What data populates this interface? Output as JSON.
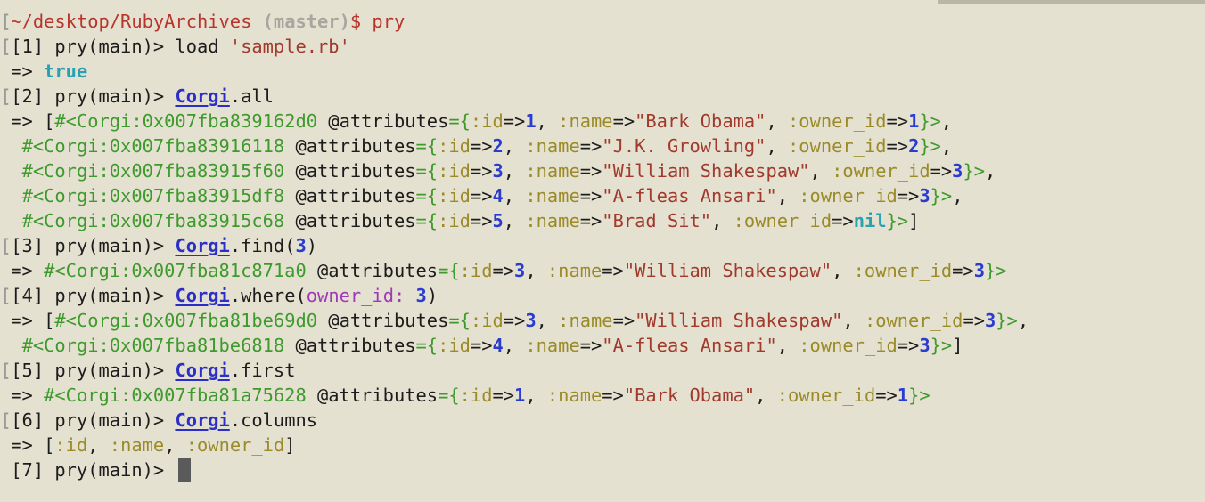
{
  "terminal": {
    "lines": [
      {
        "name": "shell-prompt-line",
        "segments": [
          {
            "t": "[",
            "c": "ed"
          },
          {
            "t": "~/desktop/RubyArchives",
            "c": "path"
          },
          {
            "t": " (master)",
            "c": "branch"
          },
          {
            "t": "$ pry",
            "c": "path"
          }
        ]
      },
      {
        "name": "pry-input-1",
        "segments": [
          {
            "t": "[",
            "c": "ed"
          },
          {
            "t": "[1] pry(main)> load ",
            "c": ""
          },
          {
            "t": "'sample.rb'",
            "c": "str"
          }
        ]
      },
      {
        "name": "pry-output-1",
        "segments": [
          {
            "t": " => ",
            "c": ""
          },
          {
            "t": "true",
            "c": "bool"
          }
        ]
      },
      {
        "name": "pry-input-2",
        "segments": [
          {
            "t": "[",
            "c": "ed"
          },
          {
            "t": "[2] pry(main)> ",
            "c": ""
          },
          {
            "t": "Corgi",
            "c": "cls"
          },
          {
            "t": ".all",
            "c": ""
          }
        ]
      },
      {
        "name": "pry-output-2-line-1",
        "segments": [
          {
            "t": " => [",
            "c": ""
          },
          {
            "t": "#<Corgi:0x007fba839162d0",
            "c": "obj"
          },
          {
            "t": " @attributes",
            "c": ""
          },
          {
            "t": "={",
            "c": "obj"
          },
          {
            "t": ":id",
            "c": "sym"
          },
          {
            "t": "=>",
            "c": ""
          },
          {
            "t": "1",
            "c": "num"
          },
          {
            "t": ", ",
            "c": ""
          },
          {
            "t": ":name",
            "c": "sym"
          },
          {
            "t": "=>",
            "c": ""
          },
          {
            "t": "\"Bark Obama\"",
            "c": "str"
          },
          {
            "t": ", ",
            "c": ""
          },
          {
            "t": ":owner_id",
            "c": "sym"
          },
          {
            "t": "=>",
            "c": ""
          },
          {
            "t": "1",
            "c": "num"
          },
          {
            "t": "}>",
            "c": "obj"
          },
          {
            "t": ",",
            "c": ""
          }
        ]
      },
      {
        "name": "pry-output-2-line-2",
        "segments": [
          {
            "t": "  ",
            "c": ""
          },
          {
            "t": "#<Corgi:0x007fba83916118",
            "c": "obj"
          },
          {
            "t": " @attributes",
            "c": ""
          },
          {
            "t": "={",
            "c": "obj"
          },
          {
            "t": ":id",
            "c": "sym"
          },
          {
            "t": "=>",
            "c": ""
          },
          {
            "t": "2",
            "c": "num"
          },
          {
            "t": ", ",
            "c": ""
          },
          {
            "t": ":name",
            "c": "sym"
          },
          {
            "t": "=>",
            "c": ""
          },
          {
            "t": "\"J.K. Growling\"",
            "c": "str"
          },
          {
            "t": ", ",
            "c": ""
          },
          {
            "t": ":owner_id",
            "c": "sym"
          },
          {
            "t": "=>",
            "c": ""
          },
          {
            "t": "2",
            "c": "num"
          },
          {
            "t": "}>",
            "c": "obj"
          },
          {
            "t": ",",
            "c": ""
          }
        ]
      },
      {
        "name": "pry-output-2-line-3",
        "segments": [
          {
            "t": "  ",
            "c": ""
          },
          {
            "t": "#<Corgi:0x007fba83915f60",
            "c": "obj"
          },
          {
            "t": " @attributes",
            "c": ""
          },
          {
            "t": "={",
            "c": "obj"
          },
          {
            "t": ":id",
            "c": "sym"
          },
          {
            "t": "=>",
            "c": ""
          },
          {
            "t": "3",
            "c": "num"
          },
          {
            "t": ", ",
            "c": ""
          },
          {
            "t": ":name",
            "c": "sym"
          },
          {
            "t": "=>",
            "c": ""
          },
          {
            "t": "\"William Shakespaw\"",
            "c": "str"
          },
          {
            "t": ", ",
            "c": ""
          },
          {
            "t": ":owner_id",
            "c": "sym"
          },
          {
            "t": "=>",
            "c": ""
          },
          {
            "t": "3",
            "c": "num"
          },
          {
            "t": "}>",
            "c": "obj"
          },
          {
            "t": ",",
            "c": ""
          }
        ]
      },
      {
        "name": "pry-output-2-line-4",
        "segments": [
          {
            "t": "  ",
            "c": ""
          },
          {
            "t": "#<Corgi:0x007fba83915df8",
            "c": "obj"
          },
          {
            "t": " @attributes",
            "c": ""
          },
          {
            "t": "={",
            "c": "obj"
          },
          {
            "t": ":id",
            "c": "sym"
          },
          {
            "t": "=>",
            "c": ""
          },
          {
            "t": "4",
            "c": "num"
          },
          {
            "t": ", ",
            "c": ""
          },
          {
            "t": ":name",
            "c": "sym"
          },
          {
            "t": "=>",
            "c": ""
          },
          {
            "t": "\"A-fleas Ansari\"",
            "c": "str"
          },
          {
            "t": ", ",
            "c": ""
          },
          {
            "t": ":owner_id",
            "c": "sym"
          },
          {
            "t": "=>",
            "c": ""
          },
          {
            "t": "3",
            "c": "num"
          },
          {
            "t": "}>",
            "c": "obj"
          },
          {
            "t": ",",
            "c": ""
          }
        ]
      },
      {
        "name": "pry-output-2-line-5",
        "segments": [
          {
            "t": "  ",
            "c": ""
          },
          {
            "t": "#<Corgi:0x007fba83915c68",
            "c": "obj"
          },
          {
            "t": " @attributes",
            "c": ""
          },
          {
            "t": "={",
            "c": "obj"
          },
          {
            "t": ":id",
            "c": "sym"
          },
          {
            "t": "=>",
            "c": ""
          },
          {
            "t": "5",
            "c": "num"
          },
          {
            "t": ", ",
            "c": ""
          },
          {
            "t": ":name",
            "c": "sym"
          },
          {
            "t": "=>",
            "c": ""
          },
          {
            "t": "\"Brad Sit\"",
            "c": "str"
          },
          {
            "t": ", ",
            "c": ""
          },
          {
            "t": ":owner_id",
            "c": "sym"
          },
          {
            "t": "=>",
            "c": ""
          },
          {
            "t": "nil",
            "c": "nil"
          },
          {
            "t": "}>",
            "c": "obj"
          },
          {
            "t": "]",
            "c": ""
          }
        ]
      },
      {
        "name": "pry-input-3",
        "segments": [
          {
            "t": "[",
            "c": "ed"
          },
          {
            "t": "[3] pry(main)> ",
            "c": ""
          },
          {
            "t": "Corgi",
            "c": "cls"
          },
          {
            "t": ".find(",
            "c": ""
          },
          {
            "t": "3",
            "c": "num"
          },
          {
            "t": ")",
            "c": ""
          }
        ]
      },
      {
        "name": "pry-output-3",
        "segments": [
          {
            "t": " => ",
            "c": ""
          },
          {
            "t": "#<Corgi:0x007fba81c871a0",
            "c": "obj"
          },
          {
            "t": " @attributes",
            "c": ""
          },
          {
            "t": "={",
            "c": "obj"
          },
          {
            "t": ":id",
            "c": "sym"
          },
          {
            "t": "=>",
            "c": ""
          },
          {
            "t": "3",
            "c": "num"
          },
          {
            "t": ", ",
            "c": ""
          },
          {
            "t": ":name",
            "c": "sym"
          },
          {
            "t": "=>",
            "c": ""
          },
          {
            "t": "\"William Shakespaw\"",
            "c": "str"
          },
          {
            "t": ", ",
            "c": ""
          },
          {
            "t": ":owner_id",
            "c": "sym"
          },
          {
            "t": "=>",
            "c": ""
          },
          {
            "t": "3",
            "c": "num"
          },
          {
            "t": "}>",
            "c": "obj"
          }
        ]
      },
      {
        "name": "pry-input-4",
        "segments": [
          {
            "t": "[",
            "c": "ed"
          },
          {
            "t": "[4] pry(main)> ",
            "c": ""
          },
          {
            "t": "Corgi",
            "c": "cls"
          },
          {
            "t": ".where(",
            "c": ""
          },
          {
            "t": "owner_id:",
            "c": "kw"
          },
          {
            "t": " ",
            "c": ""
          },
          {
            "t": "3",
            "c": "num"
          },
          {
            "t": ")",
            "c": ""
          }
        ]
      },
      {
        "name": "pry-output-4-line-1",
        "segments": [
          {
            "t": " => [",
            "c": ""
          },
          {
            "t": "#<Corgi:0x007fba81be69d0",
            "c": "obj"
          },
          {
            "t": " @attributes",
            "c": ""
          },
          {
            "t": "={",
            "c": "obj"
          },
          {
            "t": ":id",
            "c": "sym"
          },
          {
            "t": "=>",
            "c": ""
          },
          {
            "t": "3",
            "c": "num"
          },
          {
            "t": ", ",
            "c": ""
          },
          {
            "t": ":name",
            "c": "sym"
          },
          {
            "t": "=>",
            "c": ""
          },
          {
            "t": "\"William Shakespaw\"",
            "c": "str"
          },
          {
            "t": ", ",
            "c": ""
          },
          {
            "t": ":owner_id",
            "c": "sym"
          },
          {
            "t": "=>",
            "c": ""
          },
          {
            "t": "3",
            "c": "num"
          },
          {
            "t": "}>",
            "c": "obj"
          },
          {
            "t": ",",
            "c": ""
          }
        ]
      },
      {
        "name": "pry-output-4-line-2",
        "segments": [
          {
            "t": "  ",
            "c": ""
          },
          {
            "t": "#<Corgi:0x007fba81be6818",
            "c": "obj"
          },
          {
            "t": " @attributes",
            "c": ""
          },
          {
            "t": "={",
            "c": "obj"
          },
          {
            "t": ":id",
            "c": "sym"
          },
          {
            "t": "=>",
            "c": ""
          },
          {
            "t": "4",
            "c": "num"
          },
          {
            "t": ", ",
            "c": ""
          },
          {
            "t": ":name",
            "c": "sym"
          },
          {
            "t": "=>",
            "c": ""
          },
          {
            "t": "\"A-fleas Ansari\"",
            "c": "str"
          },
          {
            "t": ", ",
            "c": ""
          },
          {
            "t": ":owner_id",
            "c": "sym"
          },
          {
            "t": "=>",
            "c": ""
          },
          {
            "t": "3",
            "c": "num"
          },
          {
            "t": "}>",
            "c": "obj"
          },
          {
            "t": "]",
            "c": ""
          }
        ]
      },
      {
        "name": "pry-input-5",
        "segments": [
          {
            "t": "[",
            "c": "ed"
          },
          {
            "t": "[5] pry(main)> ",
            "c": ""
          },
          {
            "t": "Corgi",
            "c": "cls"
          },
          {
            "t": ".first",
            "c": ""
          }
        ]
      },
      {
        "name": "pry-output-5",
        "segments": [
          {
            "t": " => ",
            "c": ""
          },
          {
            "t": "#<Corgi:0x007fba81a75628",
            "c": "obj"
          },
          {
            "t": " @attributes",
            "c": ""
          },
          {
            "t": "={",
            "c": "obj"
          },
          {
            "t": ":id",
            "c": "sym"
          },
          {
            "t": "=>",
            "c": ""
          },
          {
            "t": "1",
            "c": "num"
          },
          {
            "t": ", ",
            "c": ""
          },
          {
            "t": ":name",
            "c": "sym"
          },
          {
            "t": "=>",
            "c": ""
          },
          {
            "t": "\"Bark Obama\"",
            "c": "str"
          },
          {
            "t": ", ",
            "c": ""
          },
          {
            "t": ":owner_id",
            "c": "sym"
          },
          {
            "t": "=>",
            "c": ""
          },
          {
            "t": "1",
            "c": "num"
          },
          {
            "t": "}>",
            "c": "obj"
          }
        ]
      },
      {
        "name": "pry-input-6",
        "segments": [
          {
            "t": "[",
            "c": "ed"
          },
          {
            "t": "[6] pry(main)> ",
            "c": ""
          },
          {
            "t": "Corgi",
            "c": "cls"
          },
          {
            "t": ".columns",
            "c": ""
          }
        ]
      },
      {
        "name": "pry-output-6",
        "segments": [
          {
            "t": " => [",
            "c": ""
          },
          {
            "t": ":id",
            "c": "sym"
          },
          {
            "t": ", ",
            "c": ""
          },
          {
            "t": ":name",
            "c": "sym"
          },
          {
            "t": ", ",
            "c": ""
          },
          {
            "t": ":owner_id",
            "c": "sym"
          },
          {
            "t": "]",
            "c": ""
          }
        ]
      },
      {
        "name": "pry-input-7-current",
        "segments": [
          {
            "t": " [7] pry(main)> ",
            "c": ""
          }
        ]
      }
    ],
    "colors": {
      "background": "#e5e1d1",
      "text": "#1c1c1c",
      "path": "#b7352b",
      "string": "#a13a2c",
      "class": "#2c2ec8",
      "object": "#3e9a2d",
      "symbol": "#9b8b28",
      "number": "#2a3bd1",
      "boolean": "#2aa0b0",
      "keyword": "#a039b8",
      "cursor": "#5a5a5a"
    }
  }
}
